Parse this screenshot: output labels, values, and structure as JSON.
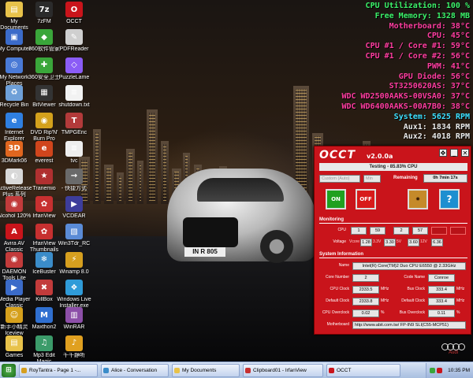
{
  "desktop": {
    "icons": [
      {
        "label": "My Documents",
        "icon": "folder-docs-icon",
        "color": "#e8c24a",
        "glyph": "▤"
      },
      {
        "label": "7zFM",
        "icon": "archive-icon",
        "color": "#2b2b2b",
        "glyph": "7z"
      },
      {
        "label": "OCCT",
        "icon": "occt-icon",
        "color": "#c9141b",
        "glyph": "O"
      },
      {
        "label": "My Computer",
        "icon": "computer-icon",
        "color": "#3b6bc9",
        "glyph": "▣"
      },
      {
        "label": "360软件管家",
        "icon": "software-manager-icon",
        "color": "#3aa63a",
        "glyph": "◆"
      },
      {
        "label": "PDFReader",
        "icon": "pdf-reader-icon",
        "color": "#cfcfcf",
        "glyph": "✎"
      },
      {
        "label": "My Network Places",
        "icon": "network-icon",
        "color": "#4a7ad6",
        "glyph": "◎"
      },
      {
        "label": "360安全卫士",
        "icon": "security-guard-icon",
        "color": "#3aa63a",
        "glyph": "✚"
      },
      {
        "label": "PuzzleLame",
        "icon": "puzzle-icon",
        "color": "#8b5cf6",
        "glyph": "◇"
      },
      {
        "label": "Recycle Bin",
        "icon": "recycle-bin-icon",
        "color": "#6fa0d8",
        "glyph": "♻"
      },
      {
        "label": "BitViewer",
        "icon": "bitviewer-icon",
        "color": "#333333",
        "glyph": "▦"
      },
      {
        "label": "shutdown.txt",
        "icon": "text-file-icon",
        "color": "#f2f2f2",
        "glyph": "≡"
      },
      {
        "label": "Internet Explorer",
        "icon": "ie-icon",
        "color": "#2f7fe0",
        "glyph": "e"
      },
      {
        "label": "DVD Rip'N' Burn Pro",
        "icon": "dvd-icon",
        "color": "#d4a11c",
        "glyph": "◉"
      },
      {
        "label": "TMPGEnc",
        "icon": "tmpgenc-icon",
        "color": "#b23a3a",
        "glyph": "T"
      },
      {
        "label": "3DMark06",
        "icon": "3dmark-icon",
        "color": "#e0661f",
        "glyph": "3D"
      },
      {
        "label": "everest",
        "icon": "everest-icon",
        "color": "#d0451c",
        "glyph": "e"
      },
      {
        "label": "tvc",
        "icon": "tvc-file-icon",
        "color": "#eeeeee",
        "glyph": "≡"
      },
      {
        "label": "ActiveRelease Plus 系列",
        "icon": "active-release-icon",
        "color": "#d8d8d8",
        "glyph": "◐"
      },
      {
        "label": "Tranemio",
        "icon": "tranemio-icon",
        "color": "#b03030",
        "glyph": "★"
      },
      {
        "label": "- 快捷方式",
        "icon": "shortcut-icon",
        "color": "#6a6a6a",
        "glyph": "→"
      },
      {
        "label": "Alcohol 120%",
        "icon": "alcohol-icon",
        "color": "#c23b3b",
        "glyph": "◉"
      },
      {
        "label": "IrfanView",
        "icon": "irfanview-icon",
        "color": "#c73030",
        "glyph": "✿"
      },
      {
        "label": "VCDEAR",
        "icon": "vcdear-icon",
        "color": "#3d3d9b",
        "glyph": "▶"
      },
      {
        "label": "Avira AV Classic",
        "icon": "avira-icon",
        "color": "#c9141b",
        "glyph": "A"
      },
      {
        "label": "IrfanView Thumbnails",
        "icon": "irfanview-thumbs-icon",
        "color": "#c73030",
        "glyph": "✿"
      },
      {
        "label": "Win3Tdr_RC",
        "icon": "win3tdr-icon",
        "color": "#5a8bd6",
        "glyph": "▧"
      },
      {
        "label": "DAEMON Tools Lite",
        "icon": "daemon-tools-icon",
        "color": "#c23b3b",
        "glyph": "◉"
      },
      {
        "label": "IceBuster",
        "icon": "icebuster-icon",
        "color": "#3b8cc9",
        "glyph": "❄"
      },
      {
        "label": "Winamp 8.0",
        "icon": "winamp-icon",
        "color": "#d69f1f",
        "glyph": "⚡"
      },
      {
        "label": "Media Player Classic",
        "icon": "media-player-icon",
        "color": "#3b6bc9",
        "glyph": "▶"
      },
      {
        "label": "KillBox",
        "icon": "killbox-icon",
        "color": "#c23b3b",
        "glyph": "✖"
      },
      {
        "label": "Windows Live Installer.exe",
        "icon": "windows-live-icon",
        "color": "#2f9bd8",
        "glyph": "❖"
      },
      {
        "label": "新手小精灵 Iceview",
        "icon": "iceview-icon",
        "color": "#d6a01c",
        "glyph": "☺"
      },
      {
        "label": "Maxthon2",
        "icon": "maxthon-icon",
        "color": "#2f6fd0",
        "glyph": "M"
      },
      {
        "label": "WinRAR",
        "icon": "winrar-icon",
        "color": "#8c4fa8",
        "glyph": "▥"
      },
      {
        "label": "Games",
        "icon": "games-folder-icon",
        "color": "#e8c24a",
        "glyph": "▤"
      },
      {
        "label": "Mp3 Edit Magic",
        "icon": "mp3-edit-icon",
        "color": "#3b9b6a",
        "glyph": "♫"
      },
      {
        "label": "千千静听",
        "icon": "ttplayer-icon",
        "color": "#e0a020",
        "glyph": "♪"
      }
    ]
  },
  "osd": [
    {
      "label": "CPU Utilization: 100 %",
      "color": "green"
    },
    {
      "label": "Free Memory: 1328 MB",
      "color": "green"
    },
    {
      "label": "Motherboard: 38°C",
      "color": "pink"
    },
    {
      "label": "CPU: 45°C",
      "color": "pink"
    },
    {
      "label": "CPU #1 / Core #1: 59°C",
      "color": "pink"
    },
    {
      "label": "CPU #1 / Core #2: 56°C",
      "color": "pink"
    },
    {
      "label": "PWM: 41°C",
      "color": "pink"
    },
    {
      "label": "GPU Diode: 56°C",
      "color": "pink"
    },
    {
      "label": "ST3250620AS: 37°C",
      "color": "pink"
    },
    {
      "label": "WDC WD2500AAKS-00VSA0: 37°C",
      "color": "pink"
    },
    {
      "label": "WDC WD6400AAKS-00A7B0: 38°C",
      "color": "pink"
    },
    {
      "label": "System: 5625 RPM",
      "color": "blue"
    },
    {
      "label": "Aux1: 1834 RPM",
      "color": "white"
    },
    {
      "label": "Aux2: 4018 RPM",
      "color": "white"
    }
  ],
  "occt": {
    "title": "OCCT",
    "version": "v2.0.0a",
    "status": "Testing - 85.83% CPU",
    "test_mode": "Custom (Auto)",
    "duration_unit": "Min",
    "remaining_label": "Remaining",
    "remaining_value": "0h 7min 17s",
    "on_label": "ON",
    "off_label": "OFF",
    "monitoring_title": "Monitoring",
    "cpu_label": "CPU",
    "cpu_values": [
      "1",
      "59",
      "2",
      "57",
      "",
      ""
    ],
    "voltage_label": "Voltage",
    "voltage_values": [
      "Vcore",
      "1.28",
      "3.3V",
      "3.30",
      "5V",
      "3.60",
      "12V",
      "6.36"
    ],
    "sysinfo_title": "System Information",
    "name_label": "Name",
    "name_value": "Intel(R) Core(TM)2 Duo CPU E6550 @ 2.33GHz",
    "core_number_label": "Core Number",
    "core_number_value": "2",
    "code_name_label": "Code Name",
    "code_name_value": "Conroe",
    "cpu_clock_label": "CPU Clock",
    "cpu_clock_value": "2333.5",
    "bus_clock_label": "Bus Clock",
    "bus_clock_value": "333.4",
    "default_clock_label": "Default Clock",
    "default_clock_value": "2333.8",
    "default_clock2_label": "Default Clock",
    "default_clock2_value": "333.4",
    "cpu_overclock_label": "CPU Overclock",
    "cpu_overclock_value": "0.02",
    "bus_overclock_label": "Bus Overclock",
    "bus_overclock_value": "0.11",
    "motherboard_label": "Motherboard",
    "motherboard_value": "http://www.abit.com.tw/ FP-IN9 SLI(C55-MCP51)",
    "unit_mhz": "MHz",
    "unit_pct": "%"
  },
  "wallpaper": {
    "plate": "IN R 805",
    "audi_text": "Audi"
  },
  "taskbar": {
    "start_label": "⊞",
    "tasks": [
      {
        "label": "RoyTantra - Page 1 -...",
        "color": "#d69f1f"
      },
      {
        "label": "Alice - Conversation",
        "color": "#3b8cc9"
      },
      {
        "label": "My Documents",
        "color": "#e8c24a"
      },
      {
        "label": "Clipboard01 - IrfanView",
        "color": "#c73030"
      },
      {
        "label": "OCCT",
        "color": "#c9141b"
      }
    ],
    "clock": "10:35 PM"
  }
}
